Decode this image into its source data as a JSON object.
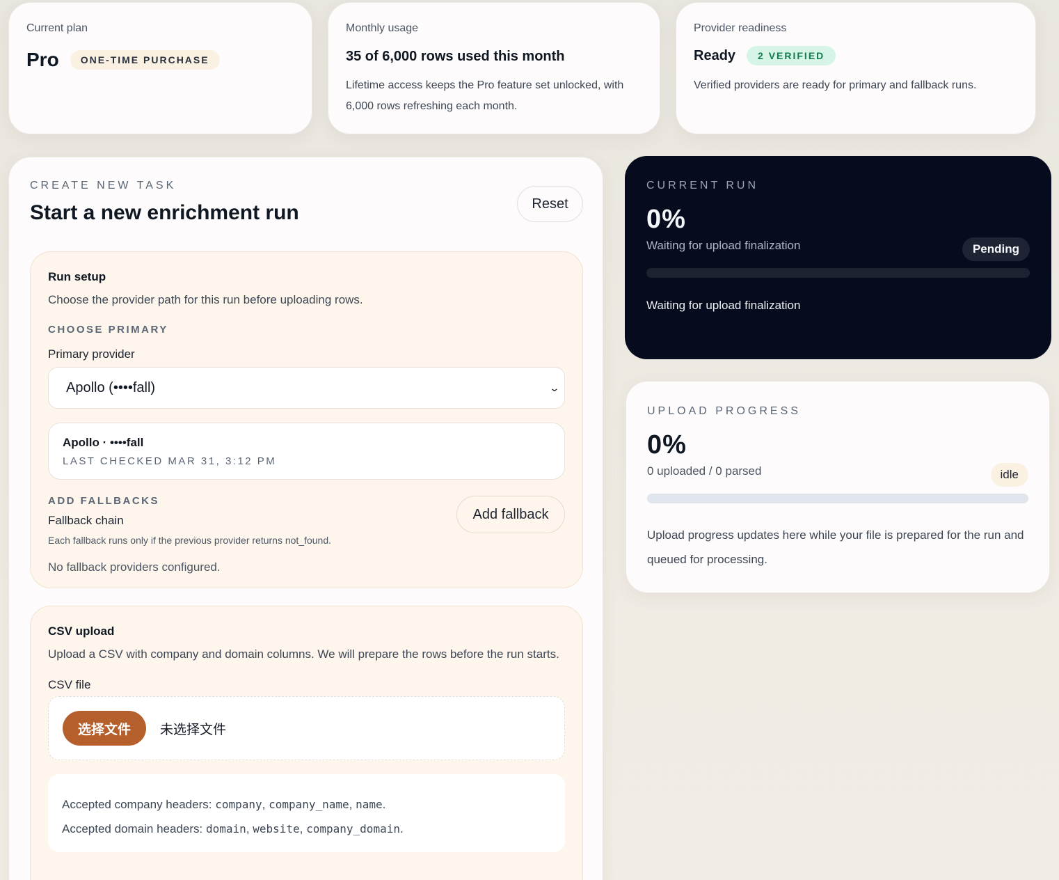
{
  "plan": {
    "label": "Current plan",
    "name": "Pro",
    "badge": "ONE-TIME PURCHASE"
  },
  "usage": {
    "label": "Monthly usage",
    "title": "35 of 6,000 rows used this month",
    "body": "Lifetime access keeps the Pro feature set unlocked, with 6,000 rows refreshing each month."
  },
  "readiness": {
    "label": "Provider readiness",
    "status": "Ready",
    "badge": "2 VERIFIED",
    "body": "Verified providers are ready for primary and fallback runs."
  },
  "task": {
    "eyebrow": "CREATE NEW TASK",
    "title": "Start a new enrichment run",
    "reset_label": "Reset",
    "setup": {
      "title": "Run setup",
      "description": "Choose the provider path for this run before uploading rows.",
      "primary_eyebrow": "CHOOSE PRIMARY",
      "primary_label": "Primary provider",
      "primary_selected": "Apollo (••••fall)",
      "provider_card_name": "Apollo · ••••fall",
      "provider_card_meta": "LAST CHECKED MAR 31, 3:12 PM",
      "fallback_eyebrow": "ADD FALLBACKS",
      "fallback_title": "Fallback chain",
      "fallback_note": "Each fallback runs only if the previous provider returns not_found.",
      "add_fallback_label": "Add fallback",
      "no_fallbacks": "No fallback providers configured."
    },
    "csv": {
      "title": "CSV upload",
      "description": "Upload a CSV with company and domain columns. We will prepare the rows before the run starts.",
      "file_label": "CSV file",
      "choose_button": "选择文件",
      "no_file": "未选择文件",
      "company_prefix": "Accepted company headers: ",
      "company_headers": [
        "company",
        "company_name",
        "name"
      ],
      "domain_prefix": "Accepted domain headers: ",
      "domain_headers": [
        "domain",
        "website",
        "company_domain"
      ]
    }
  },
  "current_run": {
    "eyebrow": "CURRENT RUN",
    "percent": "0%",
    "subtitle": "Waiting for upload finalization",
    "status": "Pending",
    "progress": 0,
    "message": "Waiting for upload finalization"
  },
  "upload_progress": {
    "eyebrow": "UPLOAD PROGRESS",
    "percent": "0%",
    "counts": "0 uploaded / 0 parsed",
    "status": "idle",
    "progress": 0,
    "message": "Upload progress updates here while your file is prepared for the run and queued for processing."
  },
  "colors": {
    "accent": "#b5602c",
    "dark_card": "#060b1d",
    "verified_bg": "#d6f5e7",
    "verified_text": "#127a4f"
  }
}
